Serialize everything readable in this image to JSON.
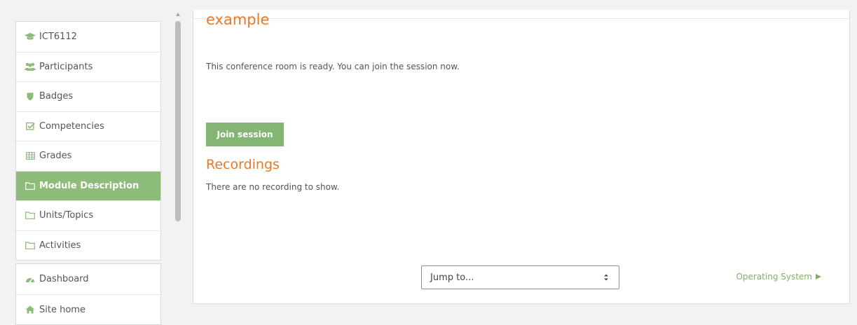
{
  "sidebar": {
    "course_items": [
      {
        "label": "ICT6112",
        "icon": "graduation-cap-icon"
      },
      {
        "label": "Participants",
        "icon": "users-icon"
      },
      {
        "label": "Badges",
        "icon": "shield-icon"
      },
      {
        "label": "Competencies",
        "icon": "check-square-icon"
      },
      {
        "label": "Grades",
        "icon": "table-icon"
      },
      {
        "label": "Module Description",
        "icon": "folder-icon",
        "active": true
      },
      {
        "label": "Units/Topics",
        "icon": "folder-icon"
      },
      {
        "label": "Activities",
        "icon": "folder-icon"
      }
    ],
    "site_items": [
      {
        "label": "Dashboard",
        "icon": "dashboard-icon"
      },
      {
        "label": "Site home",
        "icon": "home-icon"
      }
    ]
  },
  "main": {
    "title": "example",
    "status_text": "This conference room is ready. You can join the session now.",
    "join_button": "Join session",
    "recordings_title": "Recordings",
    "no_recordings_text": "There are no recording to show.",
    "jump_select": {
      "selected": "Jump to..."
    },
    "next_link": "Operating System"
  },
  "colors": {
    "accent_orange": "#e77a26",
    "active_green": "#8cbb7a",
    "button_green": "#84b574",
    "link_green": "#7fb06a"
  }
}
